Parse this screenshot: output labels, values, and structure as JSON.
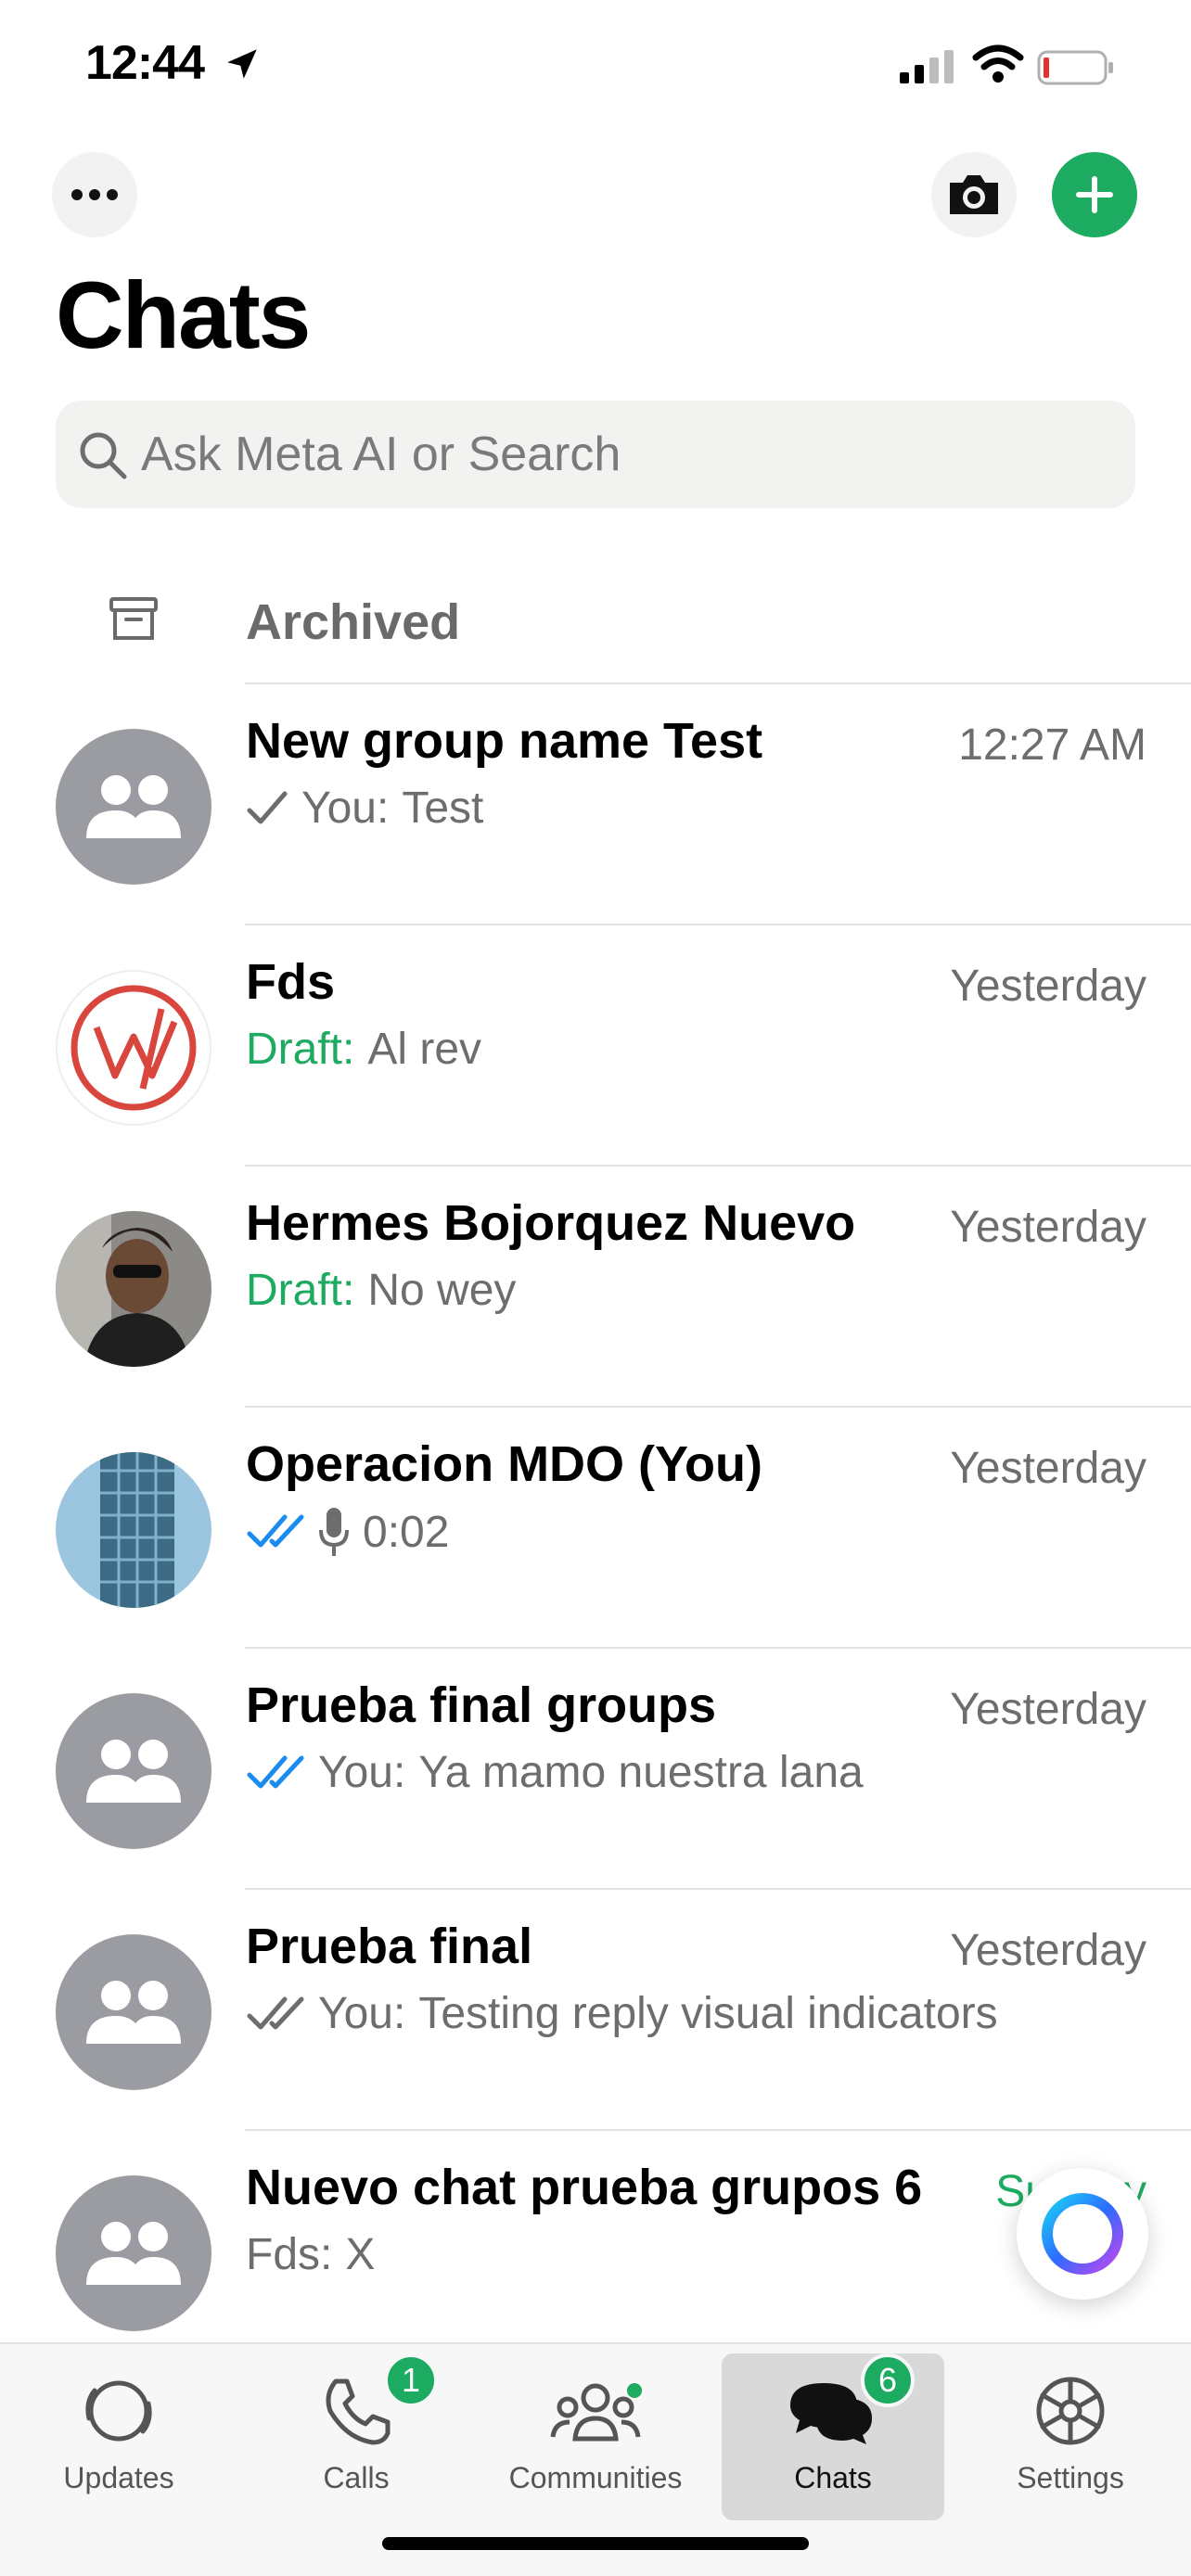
{
  "status_bar": {
    "time": "12:44"
  },
  "header": {
    "title": "Chats"
  },
  "search": {
    "placeholder": "Ask Meta AI or Search"
  },
  "archived": {
    "label": "Archived"
  },
  "chats": [
    {
      "name": "New group name Test",
      "time": "12:27 AM",
      "prefix": "You:",
      "message": "Test",
      "status": "sent",
      "avatar": "group"
    },
    {
      "name": "Fds",
      "time": "Yesterday",
      "draft_label": "Draft:",
      "message": "Al rev",
      "avatar": "logo-w"
    },
    {
      "name": "Hermes Bojorquez Nuevo",
      "time": "Yesterday",
      "draft_label": "Draft:",
      "message": "No wey",
      "avatar": "photo"
    },
    {
      "name": "Operacion MDO (You)",
      "time": "Yesterday",
      "message": "0:02",
      "status": "read",
      "avatar": "photo-building"
    },
    {
      "name": "Prueba final groups",
      "time": "Yesterday",
      "prefix": "You:",
      "message": "Ya mamo nuestra lana",
      "status": "read",
      "avatar": "group"
    },
    {
      "name": "Prueba final",
      "time": "Yesterday",
      "prefix": "You:",
      "message": "Testing reply visual indicators",
      "status": "delivered",
      "avatar": "group"
    },
    {
      "name": "Nuevo chat prueba grupos 6",
      "time": "Sunday",
      "prefix": "Fds:",
      "message": "X",
      "avatar": "group"
    }
  ],
  "tabs": [
    {
      "label": "Updates",
      "icon": "updates-icon"
    },
    {
      "label": "Calls",
      "icon": "phone-icon",
      "badge": "1"
    },
    {
      "label": "Communities",
      "icon": "communities-icon"
    },
    {
      "label": "Chats",
      "icon": "chats-icon",
      "badge": "6",
      "active": true
    },
    {
      "label": "Settings",
      "icon": "gear-icon"
    }
  ],
  "colors": {
    "accent": "#1daa61",
    "read_tick": "#1a8cf0",
    "text_secondary": "#6d6d6d"
  }
}
